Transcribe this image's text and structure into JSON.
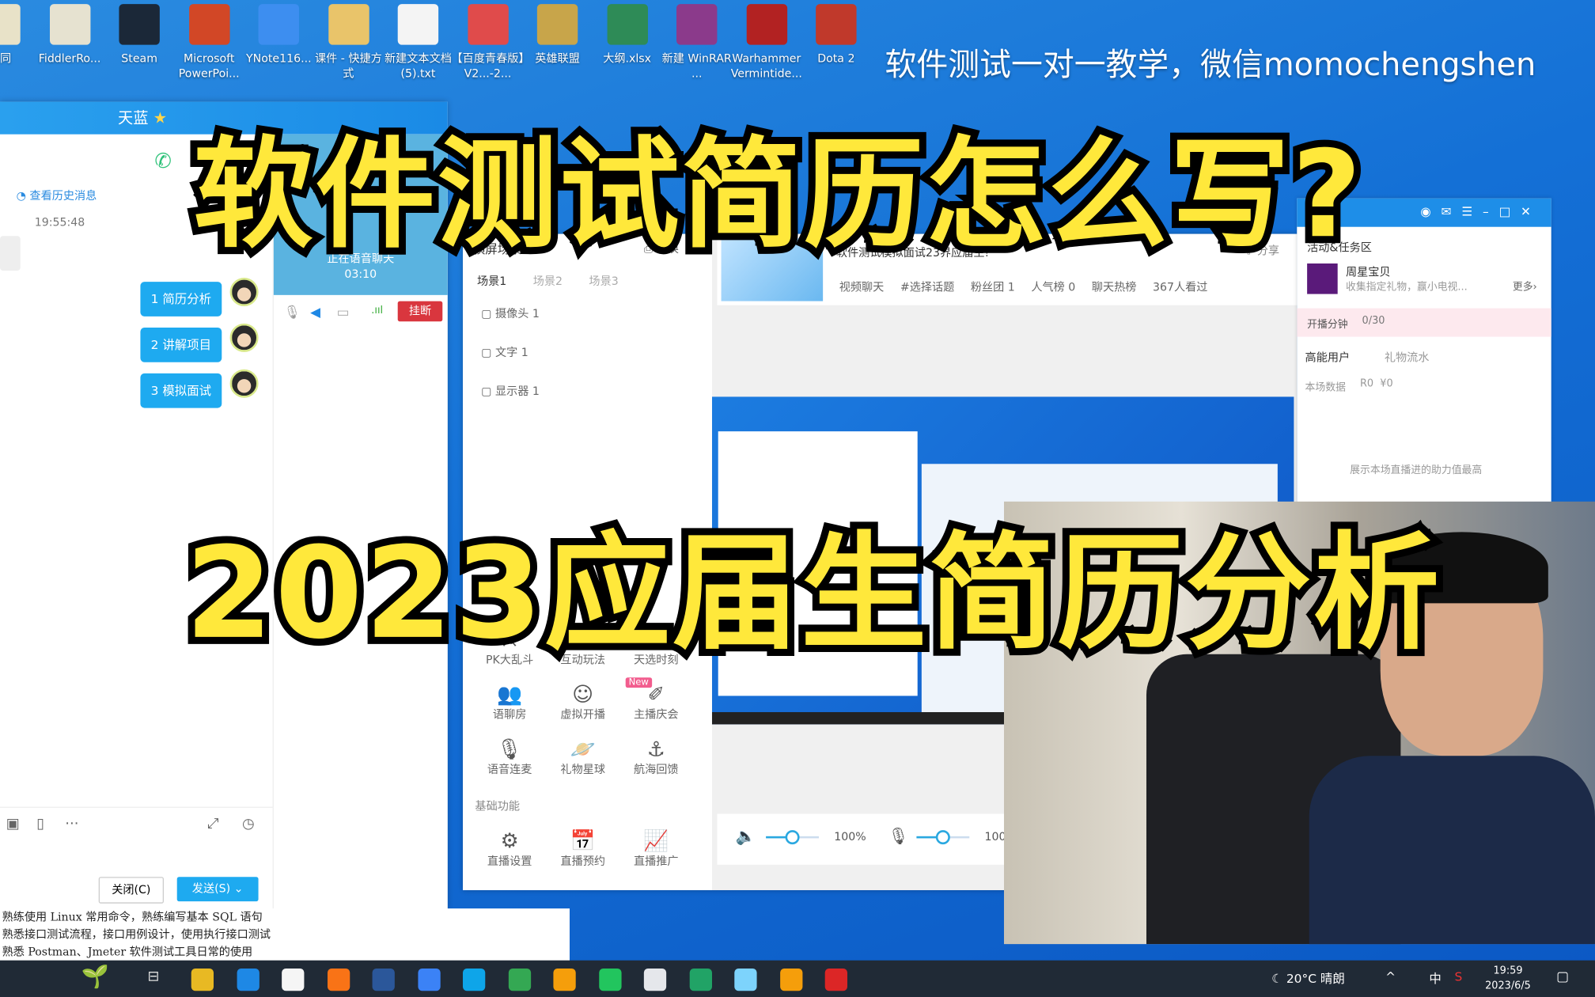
{
  "desktop": {
    "icons": [
      {
        "label": "合同",
        "color": "#e8e2c8"
      },
      {
        "label": "FiddlerRo...",
        "color": "#e6e2d0"
      },
      {
        "label": "Steam",
        "color": "#1b2838"
      },
      {
        "label": "Microsoft PowerPoi...",
        "color": "#d24726"
      },
      {
        "label": "YNote116...",
        "color": "#3d8ef0"
      },
      {
        "label": "课件 - 快捷方式",
        "color": "#e9c46a"
      },
      {
        "label": "新建文本文档(5).txt",
        "color": "#f4f4f4"
      },
      {
        "label": "【百度青春版】V2...-2...",
        "color": "#e04b4b"
      },
      {
        "label": "英雄联盟",
        "color": "#c8a54a"
      },
      {
        "label": "大纲.xlsx",
        "color": "#2e8b57"
      },
      {
        "label": "新建 WinRAR ...",
        "color": "#8b3a8b"
      },
      {
        "label": "Warhammer Vermintide...",
        "color": "#b22222"
      },
      {
        "label": "Dota 2",
        "color": "#c0392b"
      }
    ],
    "watermark": "软件测试一对一教学，微信momochengshen"
  },
  "overlay": {
    "title_line1": "软件测试简历怎么写?",
    "title_line2": "2023应届生简历分析",
    "text_color": "#ffe83b"
  },
  "chat": {
    "contact": "天蓝",
    "history_link": "查看历史消息",
    "timestamp": "19:55:48",
    "messages": [
      "1 简历分析",
      "2 讲解项目",
      "3 模拟面试"
    ],
    "voice_status": "正在语音聊天",
    "voice_time": "03:10",
    "hangup": "挂断",
    "close_btn": "关闭(C)",
    "send_btn": "发送(S)"
  },
  "document": {
    "lines": [
      "熟练使用 Linux 常用命令，熟练编写基本 SQL 语句",
      "熟悉接口测试流程，接口用例设计，使用执行接口测试",
      "熟悉 Postman、Jmeter 软件测试工具日常的使用"
    ]
  },
  "live_app": {
    "scene_title": "横屏场景",
    "switch": "切换",
    "scene_tabs": [
      "场景1",
      "场景2",
      "场景3"
    ],
    "sources": [
      "摄像头 1",
      "文字 1",
      "显示器 1"
    ],
    "features": [
      {
        "label": "PK大乱斗",
        "icon": "⚔"
      },
      {
        "label": "互动玩法",
        "icon": "✎"
      },
      {
        "label": "天选时刻",
        "icon": "?"
      },
      {
        "label": "语聊房",
        "icon": "👥"
      },
      {
        "label": "虚拟开播",
        "icon": "☺"
      },
      {
        "label": "主播庆会",
        "icon": "✐"
      },
      {
        "label": "语音连麦",
        "icon": "🎙"
      },
      {
        "label": "礼物星球",
        "icon": "🪐"
      },
      {
        "label": "航海回馈",
        "icon": "⚓"
      }
    ],
    "new_badge": "New",
    "basic_title": "基础功能",
    "basic": [
      {
        "label": "直播设置",
        "icon": "⚙"
      },
      {
        "label": "直播预约",
        "icon": "📅"
      },
      {
        "label": "直播推广",
        "icon": "📈"
      }
    ],
    "stream_title": "软件测试模拟面试23界应届生!",
    "share": "分享",
    "tags": [
      "视频聊天",
      "#选择话题",
      "粉丝团 1",
      "人气榜 0",
      "聊天热榜",
      "367人看过"
    ],
    "speaker_volume": "100%",
    "mic_volume": "100%",
    "speaker_level": 0.5,
    "mic_level": 0.5,
    "activity_title": "活动&任务区",
    "activity_name": "周星宝贝",
    "activity_desc": "收集指定礼物，赢小电视...",
    "more": "更多",
    "live_minutes_label": "开播分钟",
    "live_minutes": "0/30",
    "tab_users": "高能用户",
    "tab_gifts": "礼物流水",
    "stats_label": "本场数据",
    "stats_count": "0",
    "stats_money": "¥0",
    "empty_hint": "展示本场直播进的助力值最高"
  },
  "taskbar": {
    "weather": "20°C 晴朗",
    "ime": "中",
    "time": "19:59",
    "date": "2023/6/5",
    "apps": [
      "#e8b923",
      "#1e88e5",
      "#f5f5f5",
      "#f97316",
      "#2b579a",
      "#3b82f6",
      "#0ea5e9",
      "#34a853",
      "#f59e0b",
      "#22c55e",
      "#e5e7eb",
      "#21a366",
      "#7dd3fc",
      "#f59e0b",
      "#dc2626"
    ]
  }
}
